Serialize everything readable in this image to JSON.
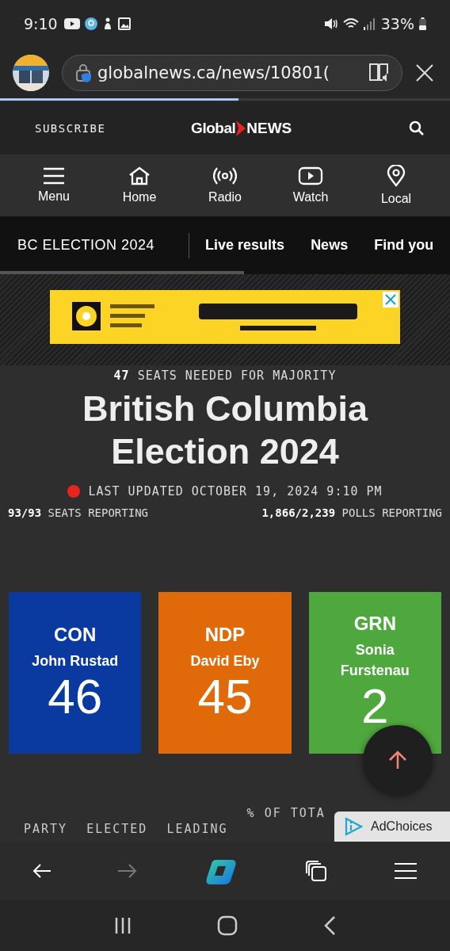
{
  "status_bar": {
    "time": "9:10",
    "battery": "33%"
  },
  "address_bar": {
    "url": "globalnews.ca/news/10801("
  },
  "page_load": {
    "level": 0.53
  },
  "site_header": {
    "subscribe": "SUBSCRIBE",
    "logo_left": "Global",
    "logo_right": "NEWS"
  },
  "nav": [
    {
      "label": "Menu",
      "kind": "menu"
    },
    {
      "label": "Home",
      "kind": "home"
    },
    {
      "label": "Radio",
      "kind": "radio"
    },
    {
      "label": "Watch",
      "kind": "watch"
    },
    {
      "label": "Local",
      "kind": "local"
    }
  ],
  "section_bar": {
    "title": "BC ELECTION 2024",
    "links": [
      "Live results",
      "News",
      "Find you"
    ]
  },
  "results": {
    "majority": "**47** SEATS NEEDED FOR MAJORITY",
    "title": "British Columbia Election 2024",
    "updated": "LAST UPDATED OCTOBER 19, 2024 9:10 PM",
    "seats_reporting": "**93/93** SEATS REPORTING",
    "polls_reporting": "**1,866/2,239** POLLS REPORTING",
    "parties": [
      {
        "party": "CON",
        "leader": "John Rustad",
        "seats": "46",
        "color": "#0a3aa0"
      },
      {
        "party": "NDP",
        "leader": "David Eby",
        "seats": "45",
        "color": "#e06a0a"
      },
      {
        "party": "GRN",
        "leader": "Sonia Furstenau",
        "seats": "2",
        "color": "#4fa83d"
      }
    ],
    "columns": [
      "PARTY",
      "ELECTED",
      "LEADING",
      "% OF TOTA"
    ]
  },
  "adchoices": "AdChoices"
}
